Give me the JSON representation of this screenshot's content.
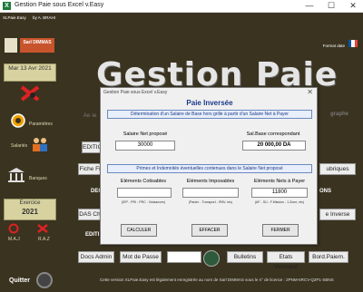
{
  "window": {
    "title": "Gestion Paie sous Excel v.Easy",
    "minimize": "—",
    "maximize": "☐",
    "close": "✕"
  },
  "sidebar": {
    "header_left": "XLPaie.Easy",
    "header_right": "by A. BRAHI",
    "company": "Sarl DIMMAS",
    "date": "Mar 13 Avr 2021",
    "parametres": "Paramètres",
    "salaries": "Salariés",
    "banques": "Banques",
    "exercice_label": "Exercice",
    "exercice_year": "2021",
    "maj": "M.A.J",
    "raz": "R.A.Z",
    "quitter": "Quitter"
  },
  "main": {
    "brand": "Gestion Paie",
    "format_label": "Format date",
    "left_items": [
      "Ae ie",
      "EDITIO",
      "Fiche Fi",
      "DECL",
      "DAS Ch",
      "EDITI"
    ],
    "right_items": [
      "graphe",
      "ubriques",
      "ONS",
      "e Inverse"
    ],
    "bottom_buttons": {
      "docs_admin": "Docs Admin",
      "mot_de_passe": "Mot de Passe",
      "bulletins": "Bulletins",
      "etats_virement": "Etats Virement",
      "bord_paiem": "Bord.Paiem."
    },
    "footer": "Cette version XLPaie.Easy est légalement enregistrée au nom de Sarl DIMMAS sous le n° de licence : 2PNM-5RCV-Q2P1-SBNS"
  },
  "dialog": {
    "title": "Gestion Paie sous Excel v.Easy",
    "close": "✕",
    "heading": "Paie Inversée",
    "subtitle": "Détermination d'un Salaire de Base hors grille à partir d'un Salaire Net à Payer",
    "net_label": "Salaire Net proposé",
    "net_value": "30000",
    "base_label": "Sal.Base correspondant",
    "base_value": "20 000,00 DA",
    "section2": "Primes et Indemnités éventuelles contenues dans le Salaire Net proposé",
    "col1_label": "Eléments Cotisables",
    "col1_value": "",
    "col1_hint": "(IEP - PRI - PRC - Nuisances)",
    "col2_label": "Eléments Imposables",
    "col2_value": "",
    "col2_hint": "(Panier - Transport - IPAV. etc)",
    "col3_label": "Eléments Nets à Payer",
    "col3_value": "11800",
    "col3_hint": "(AF - SU - F.Mission - 1.Zone, etc)",
    "btn_calculer": "CALCULER",
    "btn_effacer": "EFFACER",
    "btn_fermer": "FERMER"
  },
  "colors": {
    "sidebar_bg": "#3a3320",
    "accent_blue": "#1a3a8a"
  }
}
